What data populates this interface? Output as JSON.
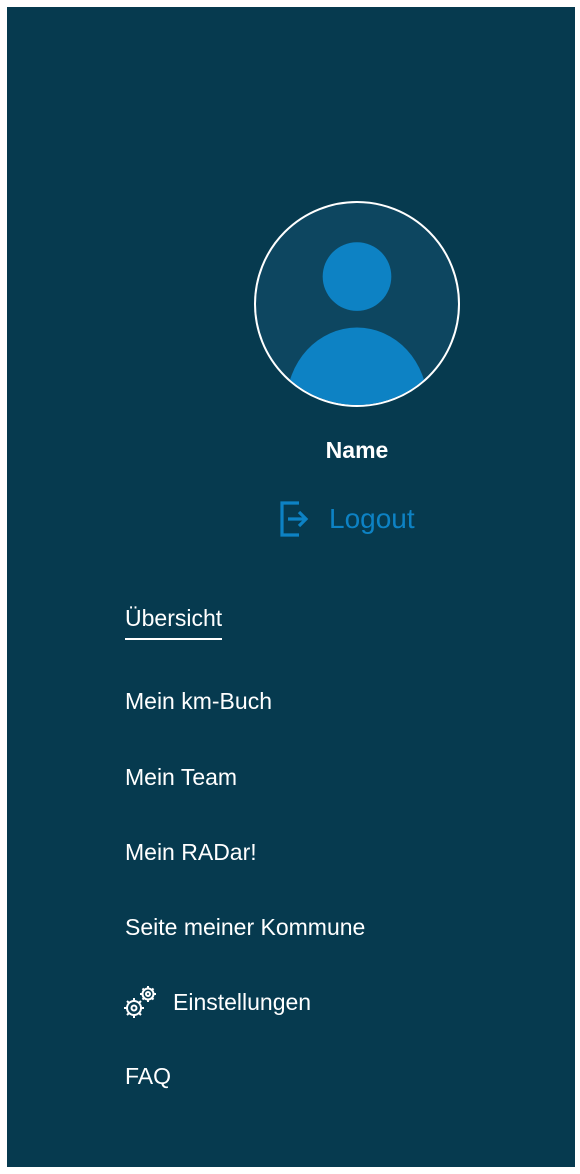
{
  "profile": {
    "name": "Name",
    "avatar_icon": "user-avatar-icon"
  },
  "logout": {
    "label": "Logout",
    "icon": "logout-icon",
    "color": "#0d82c4"
  },
  "nav": {
    "items": [
      {
        "label": "Übersicht",
        "active": true
      },
      {
        "label": "Mein km-Buch",
        "active": false
      },
      {
        "label": "Mein Team",
        "active": false
      },
      {
        "label": "Mein RADar!",
        "active": false
      },
      {
        "label": "Seite meiner Kommune",
        "active": false
      },
      {
        "label": "Einstellungen",
        "active": false,
        "icon": "gears-icon"
      },
      {
        "label": "FAQ",
        "active": false
      }
    ]
  },
  "colors": {
    "background": "#063a4f",
    "accent": "#0d82c4",
    "text": "#ffffff"
  }
}
